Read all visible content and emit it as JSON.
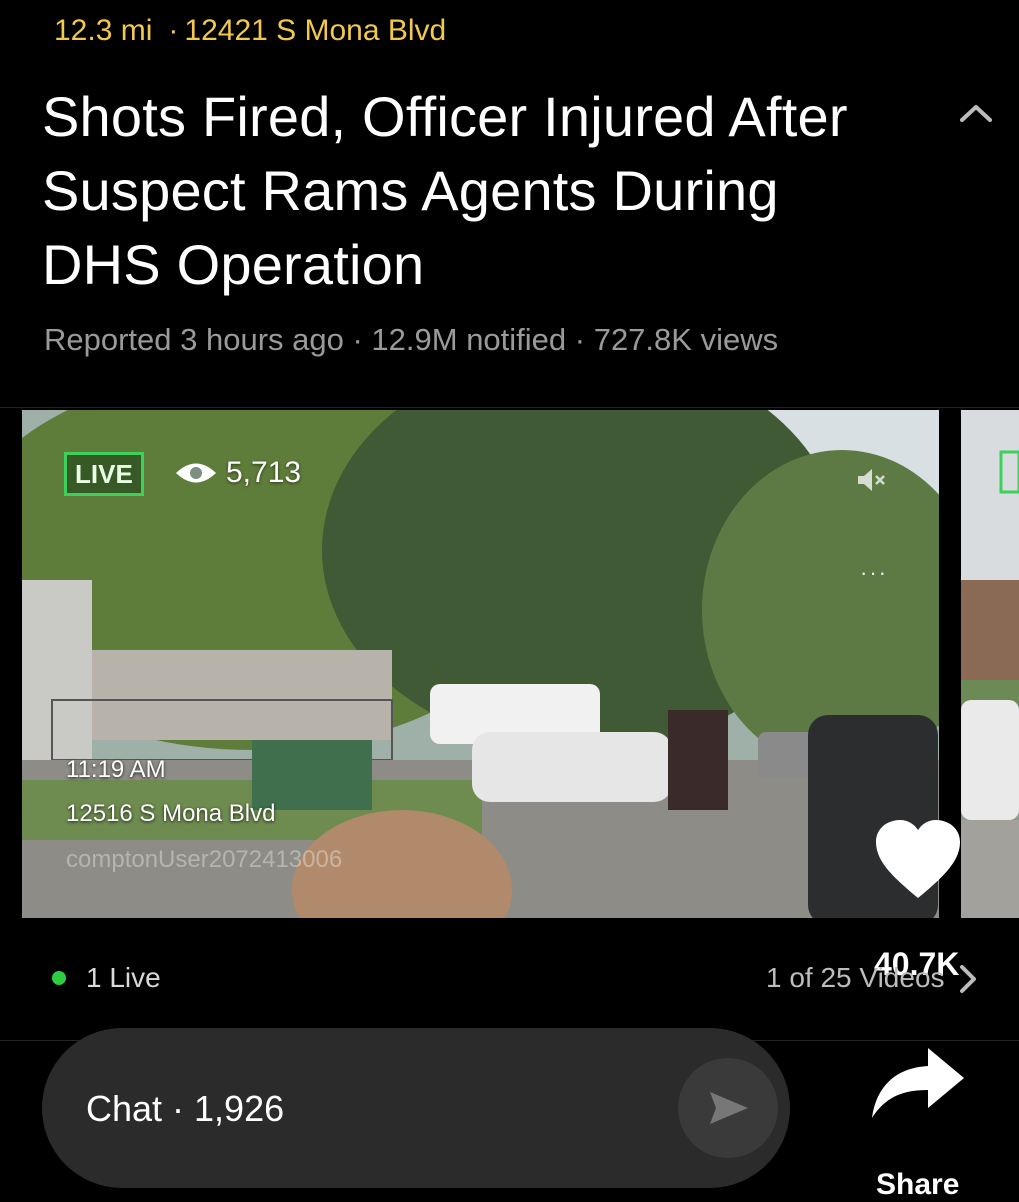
{
  "header": {
    "distance": "12.3 mi",
    "separator": "·",
    "location": "12421 S Mona Blvd",
    "title": "Shots Fired, Officer Injured After Suspect Rams Agents During DHS Operation",
    "stats": "Reported 3 hours ago · 12.9M notified · 727.8K views",
    "collapse_icon": "chevron-up-icon"
  },
  "video": {
    "live_label": "LIVE",
    "viewer_count": "5,713",
    "viewer_icon": "eye-icon",
    "mute_icon": "muted-speaker-icon",
    "more_label": "···",
    "overlay_time": "11:19 AM",
    "overlay_address": "12516 S Mona Blvd",
    "overlay_user": "comptonUser2072413006",
    "like_count": "40.7K",
    "like_icon": "heart-icon"
  },
  "carousel": {
    "live_status": "1 Live",
    "index_label": "1 of 25 Videos",
    "next_icon": "chevron-right-icon"
  },
  "chat": {
    "label": "Chat · 1,926",
    "send_icon": "send-icon"
  },
  "share": {
    "label": "Share",
    "icon": "share-arrow-icon"
  },
  "colors": {
    "accent_yellow": "#f2c94c",
    "live_green": "#3bd15a",
    "background": "#000000",
    "chat_bg": "#2b2b2b"
  }
}
